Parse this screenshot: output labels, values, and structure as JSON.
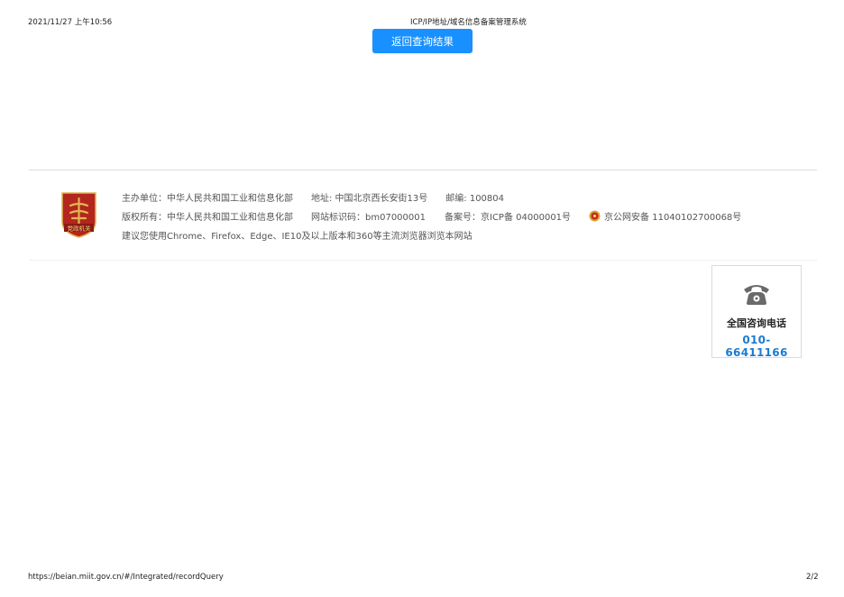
{
  "print_header": {
    "datetime": "2021/11/27 上午10:56",
    "title": "ICP/IP地址/域名信息备案管理系统"
  },
  "back_button_label": "返回查询结果",
  "footer": {
    "emblem_text": "党政机关",
    "line1": {
      "host": "主办单位：中华人民共和国工业和信息化部",
      "address": "地址: 中国北京西长安街13号",
      "postcode": "邮编: 100804"
    },
    "line2": {
      "copyright": "版权所有：中华人民共和国工业和信息化部",
      "site_id": "网站标识码：bm07000001",
      "icp": "备案号：京ICP备 04000001号",
      "police": "京公网安备 11040102700068号"
    },
    "line3": "建议您使用Chrome、Firefox、Edge、IE10及以上版本和360等主流浏览器浏览本网站"
  },
  "hotline": {
    "icon": "telephone-icon",
    "title": "全国咨询电话",
    "number": "010-66411166"
  },
  "print_footer": {
    "url": "https://beian.miit.gov.cn/#/Integrated/recordQuery",
    "page": "2/2"
  },
  "colors": {
    "button_bg": "#1890ff",
    "hotline_number": "#1a7ccf",
    "emblem_red": "#b3261e",
    "emblem_gold": "#e0b552"
  }
}
